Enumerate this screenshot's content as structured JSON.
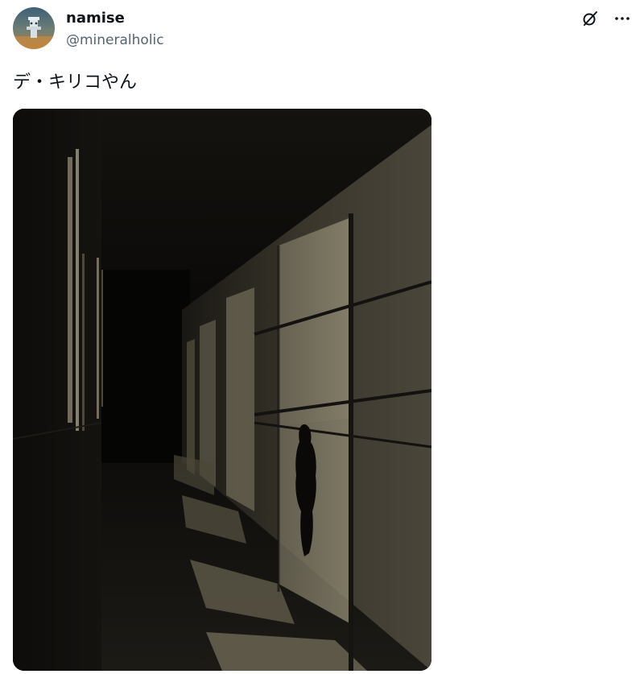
{
  "author": {
    "display_name": "namise",
    "handle": "@mineralholic"
  },
  "tweet": {
    "text": "デ・キリコやん"
  },
  "icons": {
    "grok": "grok-icon",
    "more": "more-icon"
  },
  "colors": {
    "text_primary": "#0f1419",
    "text_secondary": "#536471",
    "background": "#ffffff"
  }
}
